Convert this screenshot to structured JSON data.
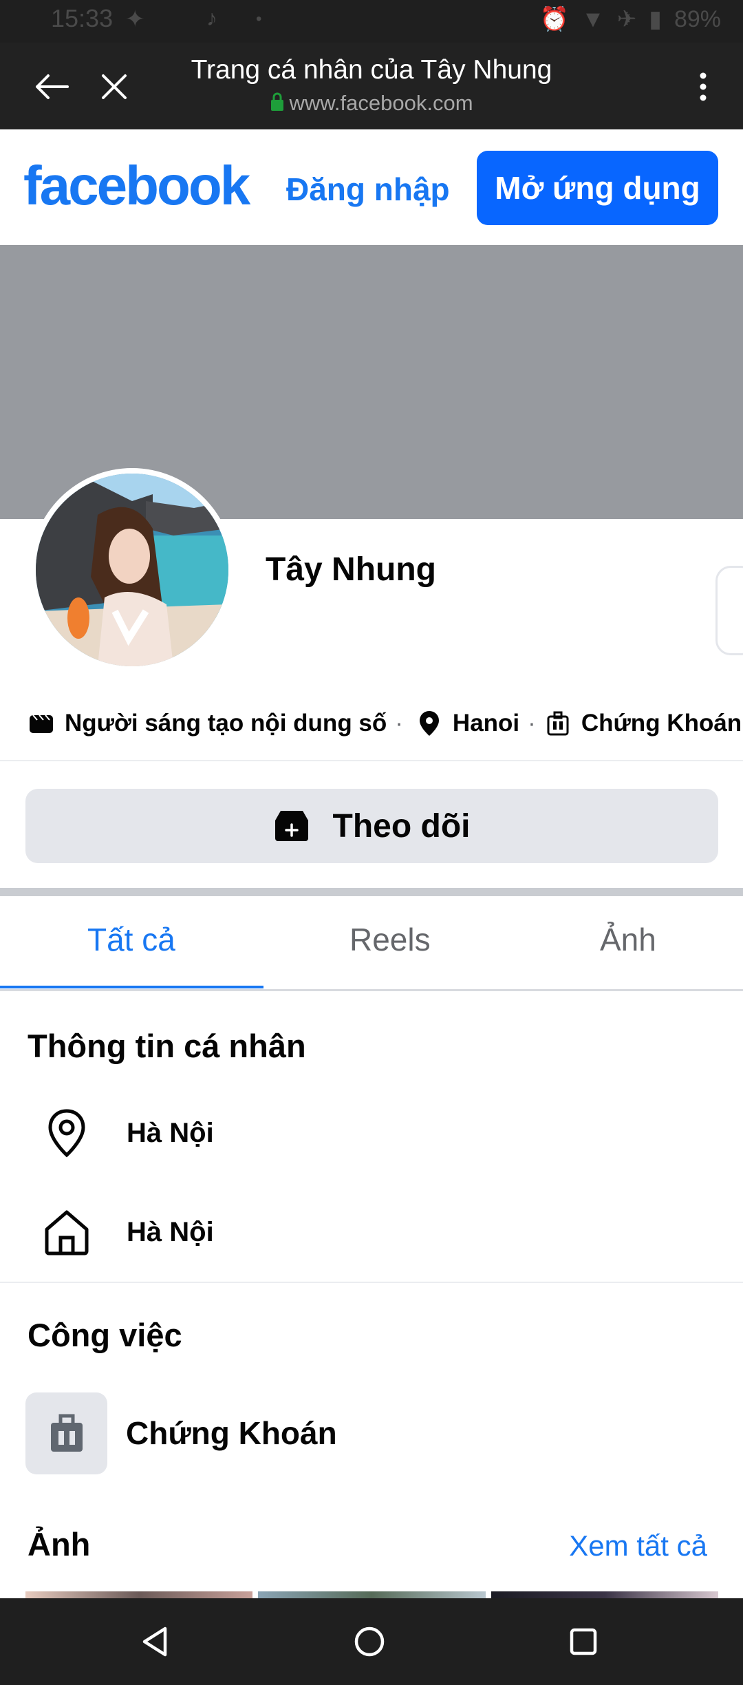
{
  "status_bar": {
    "time": "15:33",
    "battery": "89%"
  },
  "browser": {
    "title": "Trang cá nhân của Tây Nhung",
    "url": "www.facebook.com"
  },
  "fb_header": {
    "logo": "facebook",
    "login": "Đăng nhập",
    "open_app": "Mở ứng dụng"
  },
  "profile": {
    "name": "Tây Nhung",
    "intro": {
      "creator": "Người sáng tạo nội dung số",
      "city": "Hanoi",
      "work": "Chứng Khoán",
      "separator": "·"
    },
    "follow_label": "Theo dõi"
  },
  "tabs": [
    {
      "label": "Tất cả",
      "active": true
    },
    {
      "label": "Reels",
      "active": false
    },
    {
      "label": "Ảnh",
      "active": false
    }
  ],
  "personal_info": {
    "title": "Thông tin cá nhân",
    "items": [
      {
        "icon": "location-pin-icon",
        "text": "Hà Nội"
      },
      {
        "icon": "home-icon",
        "text": "Hà Nội"
      }
    ]
  },
  "work": {
    "title": "Công việc",
    "item": "Chứng Khoán",
    "icon": "briefcase-icon"
  },
  "photos": {
    "title": "Ảnh",
    "see_all": "Xem tất cả"
  },
  "colors": {
    "brand": "#1877f2",
    "button_blue": "#0866ff",
    "cover": "#979a9f",
    "gray_button": "#e4e6eb"
  }
}
